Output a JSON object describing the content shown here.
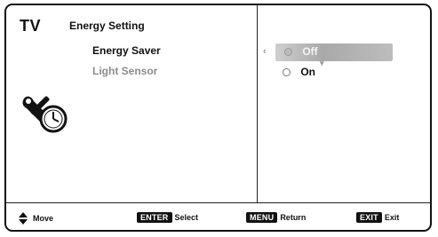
{
  "header": {
    "brand": "TV",
    "menu_title": "Energy Setting"
  },
  "menu": {
    "items": [
      {
        "label": "Energy Saver"
      },
      {
        "label": "Light Sensor"
      }
    ]
  },
  "options": [
    {
      "label": "Off",
      "selected": true
    },
    {
      "label": "On",
      "selected": false
    }
  ],
  "footer": {
    "move_label": "Move",
    "enter_key": "ENTER",
    "enter_label": "Select",
    "menu_key": "MENU",
    "menu_label": "Return",
    "exit_key": "EXIT",
    "exit_label": "Exit"
  },
  "icons": {
    "settings": "tools-clock-icon",
    "move": "up-down-arrows-icon"
  }
}
